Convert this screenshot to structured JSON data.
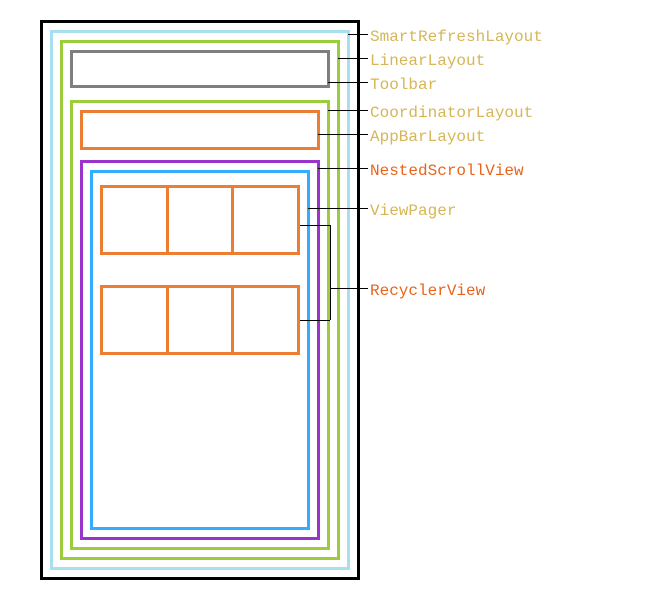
{
  "labels": {
    "smartRefresh": "SmartRefreshLayout",
    "linearLayout": "LinearLayout",
    "toolbar": "Toolbar",
    "coordinator": "CoordinatorLayout",
    "appBar": "AppBarLayout",
    "nestedScroll": "NestedScrollView",
    "viewPager": "ViewPager",
    "recycler": "RecyclerView"
  },
  "hierarchy": {
    "root": "phone-frame",
    "children": [
      "SmartRefreshLayout",
      "LinearLayout",
      "Toolbar",
      "CoordinatorLayout",
      "AppBarLayout",
      "NestedScrollView",
      "ViewPager",
      "RecyclerView",
      "RecyclerView"
    ]
  },
  "colors": {
    "smartRefresh": "#a7dff0",
    "linearLayout": "#9ccc3c",
    "toolbar": "#7f7f7f",
    "coordinator": "#9ccc3c",
    "appBar": "#ed7d31",
    "nestedScroll": "#9933cc",
    "viewPager": "#33adff",
    "recycler": "#ed7d31",
    "phoneFrame": "#000000"
  }
}
